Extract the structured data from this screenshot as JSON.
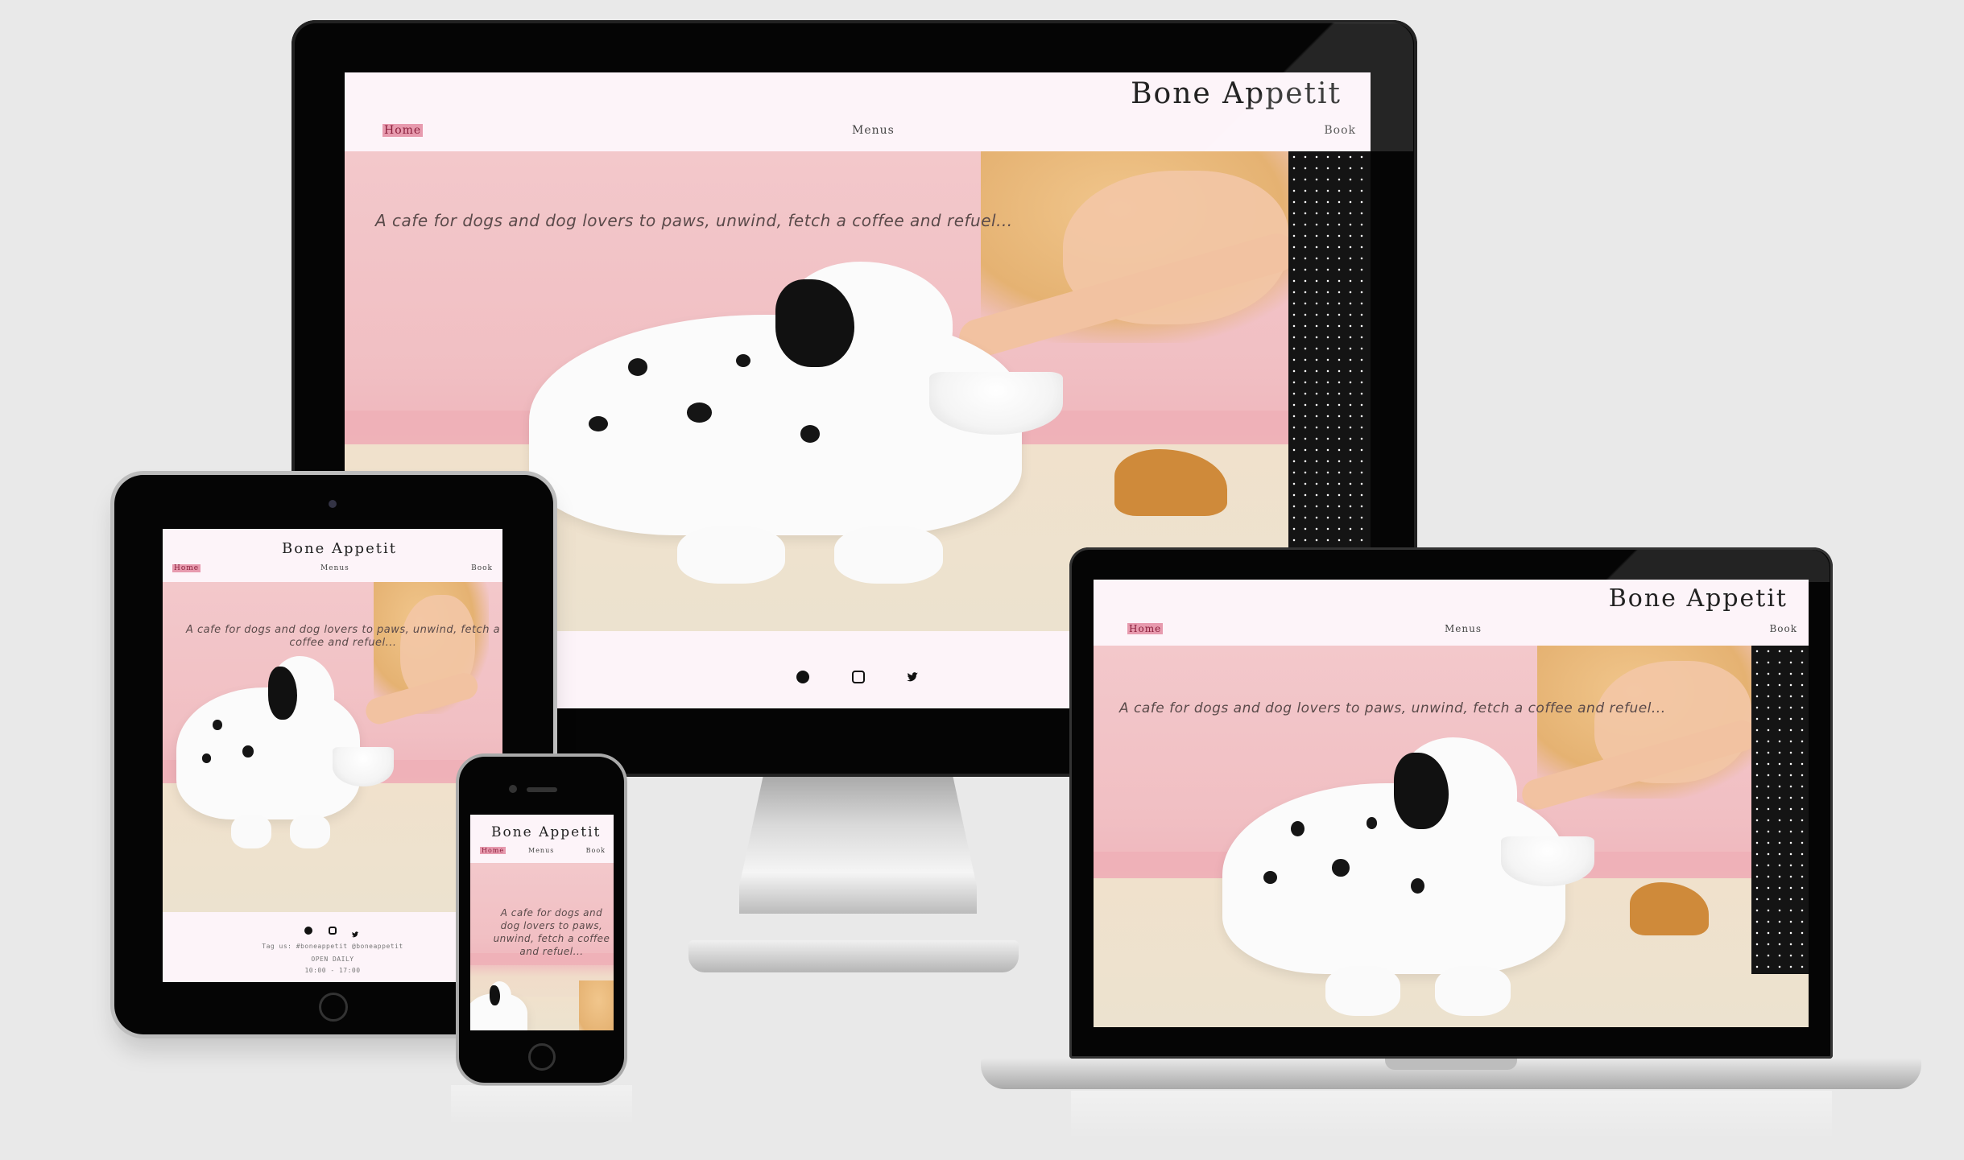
{
  "site": {
    "brand": "Bone Appetit",
    "nav": [
      "Home",
      "Menus",
      "Book"
    ],
    "tagline": "A cafe for dogs and dog lovers to paws, unwind, fetch a coffee and refuel...",
    "social_icons": [
      "facebook-icon",
      "instagram-icon",
      "twitter-icon"
    ],
    "footer": {
      "tag_line": "Tag us: #boneappetit @boneappetit",
      "hours_label": "OPEN DAILY",
      "hours": "10:00 - 17:00"
    }
  },
  "colors": {
    "page_background": "#e9e9e9",
    "site_background": "#fdf4f9",
    "active_nav_highlight": "#e79aae",
    "hero_pink": "#f1bfc3"
  }
}
